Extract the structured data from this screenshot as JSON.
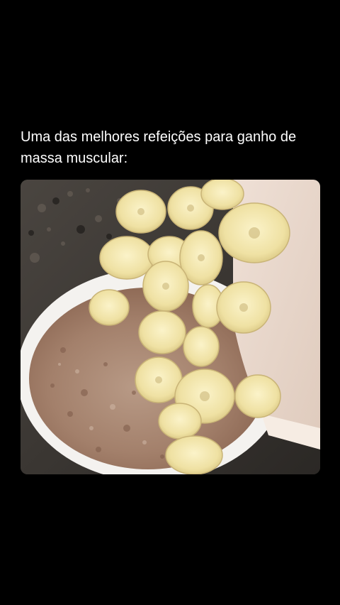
{
  "post": {
    "caption": "Uma das melhores refeições para ganho de massa muscular:",
    "media_icon": "photo-oats-bowl-with-banana-slices"
  }
}
